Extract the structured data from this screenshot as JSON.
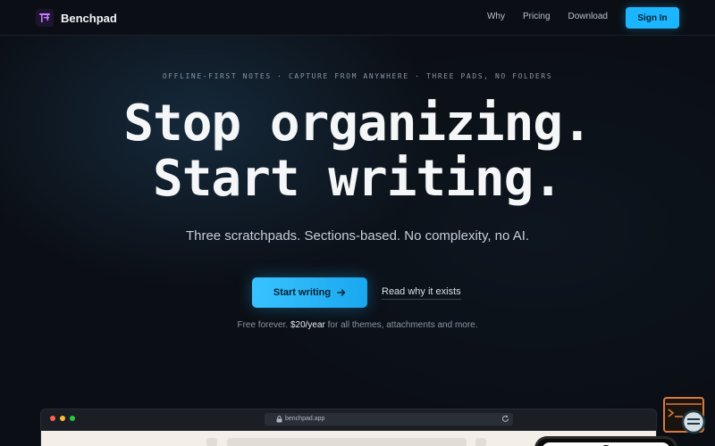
{
  "brand": {
    "name": "Benchpad",
    "logo_icon": "notepad-icon",
    "accent": "#1cb5ff",
    "logo_bg": "#1d1530",
    "logo_fg": "#c77dff"
  },
  "nav": {
    "items": [
      "Why",
      "Pricing",
      "Download"
    ],
    "signin_label": "Sign In"
  },
  "hero": {
    "tagline": "OFFLINE-FIRST NOTES · CAPTURE FROM ANYWHERE · THREE PADS, NO FOLDERS",
    "headline_line1": "Stop organizing.",
    "headline_line2": "Start writing.",
    "subtitle": "Three scratchpads. Sections-based. No complexity, no AI.",
    "cta_primary": "Start writing",
    "cta_primary_icon": "arrow-right-icon",
    "cta_secondary": "Read why it exists",
    "pricing_prefix": "Free forever.",
    "pricing_price": "$20/year",
    "pricing_suffix": "for all themes, attachments and more."
  },
  "preview": {
    "url": "benchpad.app",
    "window_dot_colors": [
      "#ff5f57",
      "#febc2e",
      "#28c840"
    ]
  },
  "help_widget": {
    "icon": "terminal-chat-icon"
  }
}
